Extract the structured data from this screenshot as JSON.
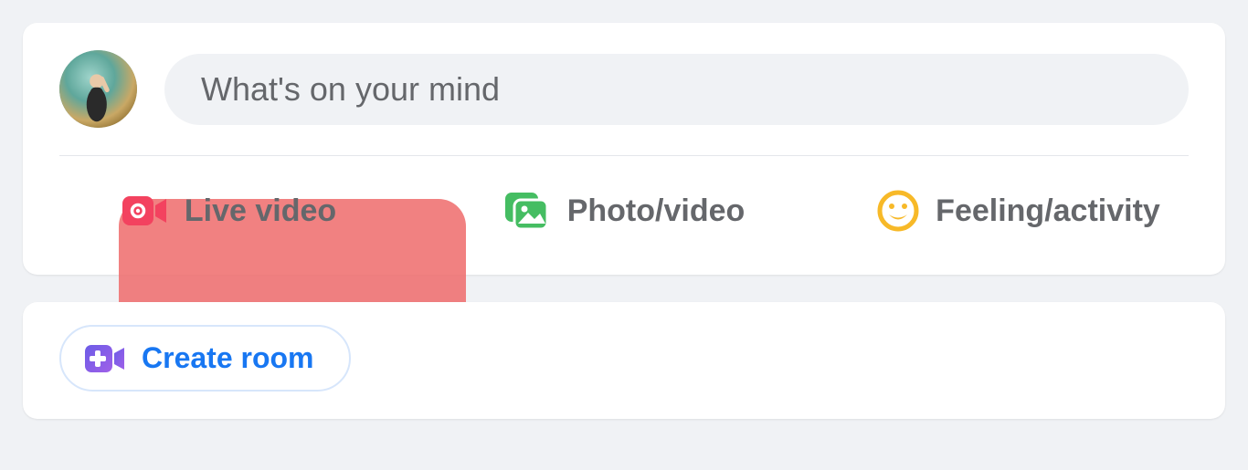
{
  "compose": {
    "placeholder": "What's on your mind"
  },
  "actions": {
    "live": "Live video",
    "photo": "Photo/video",
    "feeling": "Feeling/activity"
  },
  "room": {
    "label": "Create room"
  },
  "colors": {
    "live": "#f3425f",
    "photo": "#45bd62",
    "feeling": "#f7b928",
    "link": "#1877f2"
  }
}
